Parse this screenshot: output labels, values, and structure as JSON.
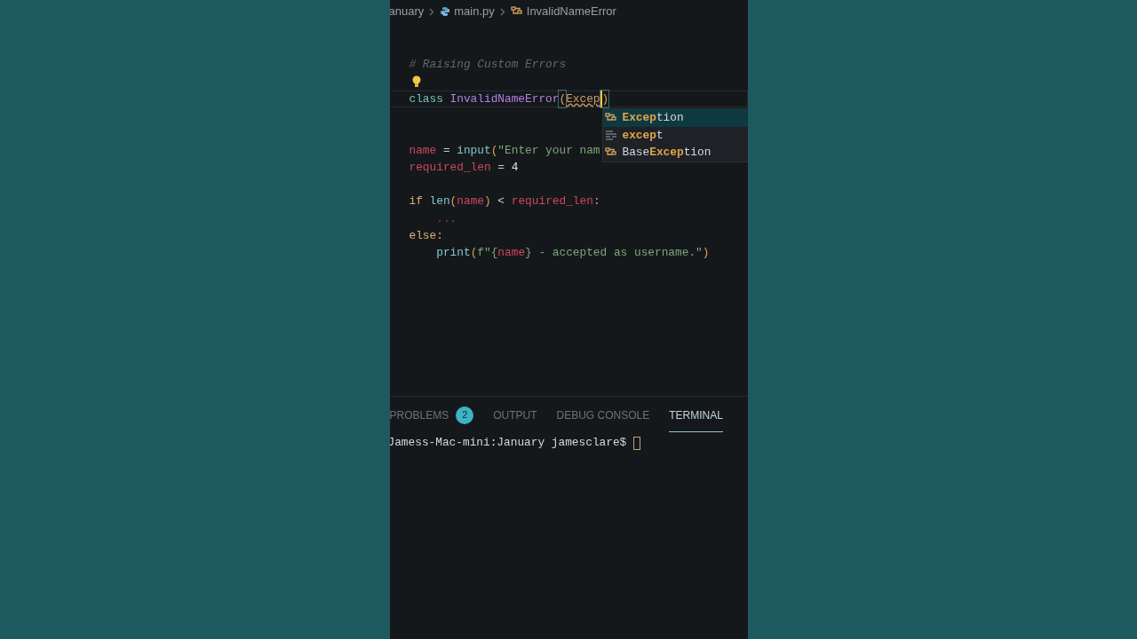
{
  "breadcrumb": [
    {
      "text": "anuary",
      "kind": "folder"
    },
    {
      "text": "main.py",
      "kind": "python"
    },
    {
      "text": "InvalidNameError",
      "kind": "class"
    }
  ],
  "code_lines": [
    {
      "kind": "code",
      "tokens": [
        {
          "text": "# Raising Custom Errors",
          "kind": "comment"
        }
      ]
    },
    {
      "kind": "code",
      "lightbulb": true
    },
    {
      "kind": "code",
      "current": true,
      "tokens": [
        {
          "text": "class ",
          "kind": "keyword"
        },
        {
          "text": "InvalidNameError",
          "kind": "classname"
        },
        {
          "text": "(",
          "kind": "bracket"
        },
        {
          "text": "Excep",
          "kind": "error"
        },
        {
          "text": ")",
          "kind": "bracket",
          "caret_before": true
        }
      ]
    },
    {
      "kind": "blank"
    },
    {
      "kind": "blank"
    },
    {
      "kind": "code",
      "tokens": [
        {
          "text": "name",
          "kind": "variable"
        },
        {
          "text": " = ",
          "kind": "plain"
        },
        {
          "text": "input",
          "kind": "function"
        },
        {
          "text": "(",
          "kind": "punct"
        },
        {
          "text": "\"Enter your nam",
          "kind": "string"
        }
      ]
    },
    {
      "kind": "code",
      "tokens": [
        {
          "text": "required_len",
          "kind": "variable"
        },
        {
          "text": " = ",
          "kind": "plain"
        },
        {
          "text": "4",
          "kind": "number"
        }
      ]
    },
    {
      "kind": "blank"
    },
    {
      "kind": "code",
      "tokens": [
        {
          "text": "if ",
          "kind": "control"
        },
        {
          "text": "len",
          "kind": "function"
        },
        {
          "text": "(",
          "kind": "punct"
        },
        {
          "text": "name",
          "kind": "variable"
        },
        {
          "text": ")",
          "kind": "punct"
        },
        {
          "text": " < ",
          "kind": "plain"
        },
        {
          "text": "required_len",
          "kind": "variable"
        },
        {
          "text": ":",
          "kind": "punct"
        }
      ]
    },
    {
      "kind": "code",
      "tokens": [
        {
          "text": "    ...",
          "kind": "ellipsis"
        }
      ]
    },
    {
      "kind": "code",
      "tokens": [
        {
          "text": "else",
          "kind": "control"
        },
        {
          "text": ":",
          "kind": "punct"
        }
      ]
    },
    {
      "kind": "code",
      "tokens": [
        {
          "text": "    print",
          "kind": "function"
        },
        {
          "text": "(",
          "kind": "punct"
        },
        {
          "text": "f\"{",
          "kind": "string"
        },
        {
          "text": "name",
          "kind": "variable"
        },
        {
          "text": "} - accepted as username.\"",
          "kind": "string"
        },
        {
          "text": ")",
          "kind": "punct"
        }
      ]
    }
  ],
  "suggestions": [
    {
      "kind": "class",
      "match": "Excep",
      "rest": "tion",
      "selected": true
    },
    {
      "kind": "keyword",
      "match": "excep",
      "rest": "t",
      "selected": false
    },
    {
      "kind": "class",
      "prefix": "Base",
      "match": "Excep",
      "rest": "tion",
      "selected": false
    }
  ],
  "panel_tabs": [
    {
      "label": "PROBLEMS",
      "badge": "2",
      "selected": false
    },
    {
      "label": "OUTPUT",
      "selected": false
    },
    {
      "label": "DEBUG CONSOLE",
      "selected": false
    },
    {
      "label": "TERMINAL",
      "selected": true
    }
  ],
  "terminal": {
    "prompt": "Jamess-Mac-mini:January jamesclare$"
  }
}
